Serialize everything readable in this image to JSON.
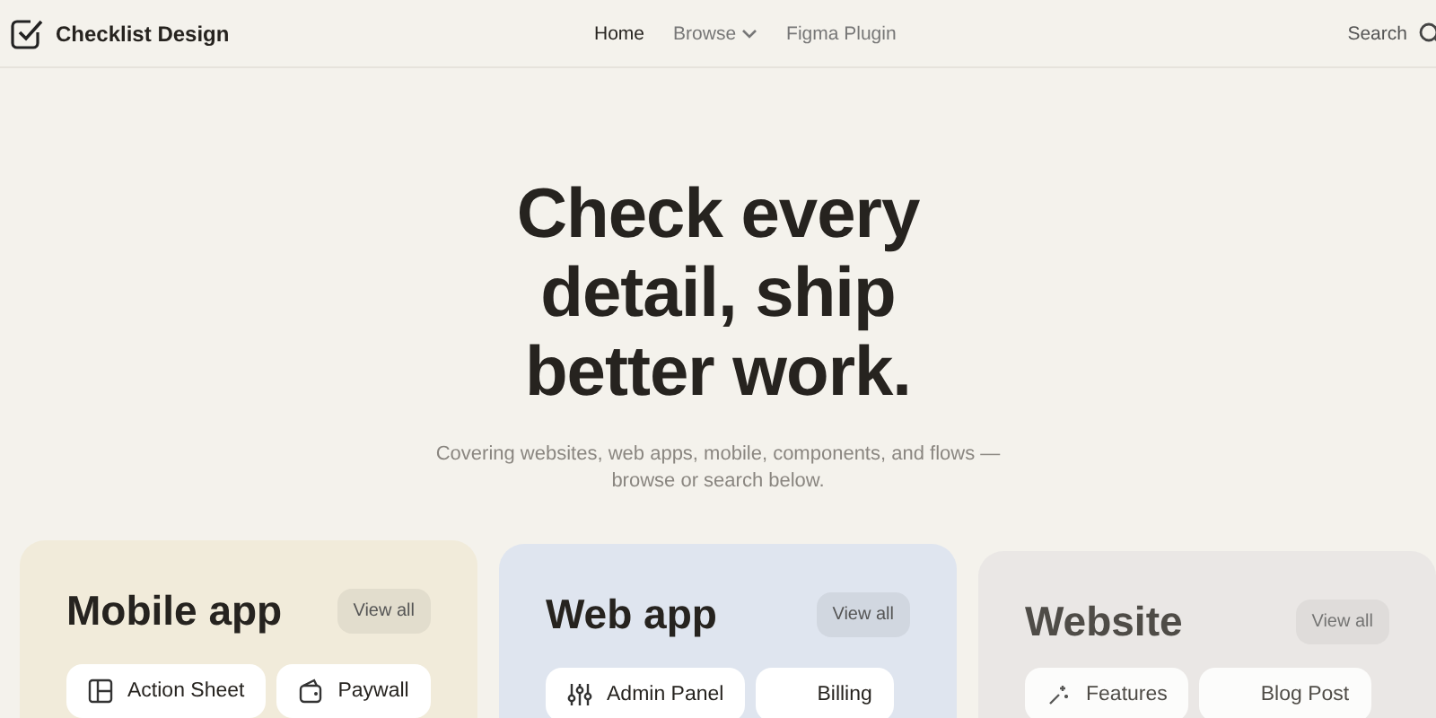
{
  "header": {
    "brand": "Checklist Design",
    "nav": [
      {
        "label": "Home",
        "selected": true,
        "dropdown": false
      },
      {
        "label": "Browse",
        "selected": false,
        "dropdown": true
      },
      {
        "label": "Figma Plugin",
        "selected": false,
        "dropdown": false
      }
    ],
    "search": "Search"
  },
  "hero": {
    "title_lines": [
      "Check every",
      "detail, ship",
      "better work."
    ],
    "subtitle_lines": [
      "Covering websites, web apps, mobile, components, and flows —",
      "browse or search below."
    ]
  },
  "categories": [
    {
      "title": "Mobile app",
      "action": "View all",
      "color": "#f1ebda",
      "chips": [
        {
          "label": "Action Sheet",
          "kind": "layout"
        },
        {
          "label": "Paywall",
          "kind": "wallet"
        }
      ]
    },
    {
      "title": "Web app",
      "action": "View all",
      "color": "#dfe5ef",
      "chips": [
        {
          "label": "Admin Panel",
          "kind": "sliders"
        },
        {
          "label": "Billing",
          "kind": "plain"
        }
      ]
    },
    {
      "title": "Website",
      "action": "View all",
      "color": "#e8e5e4",
      "chips": [
        {
          "label": "Features",
          "kind": "sparkle"
        },
        {
          "label": "Blog Post",
          "kind": "plain"
        }
      ]
    }
  ]
}
